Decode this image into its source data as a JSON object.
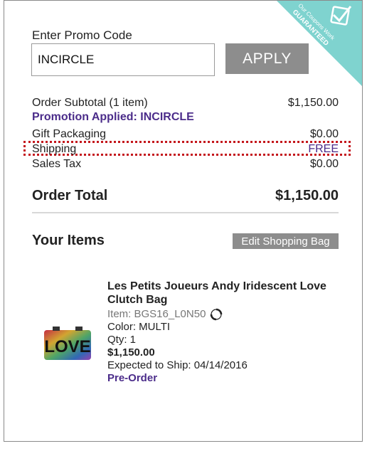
{
  "promo": {
    "label": "Enter Promo Code",
    "input_value": "INCIRCLE",
    "apply_label": "APPLY"
  },
  "badge": {
    "line1": "Our Coupons Work",
    "line2": "GUARANTEED",
    "icon": "checkmark-icon",
    "color": "#7fd3cf"
  },
  "summary": {
    "subtotal_label": "Order Subtotal (1 item)",
    "subtotal_value": "$1,150.00",
    "promotion_text": "Promotion Applied: INCIRCLE",
    "gift_label": "Gift Packaging",
    "gift_value": "$0.00",
    "shipping_label": "Shipping",
    "shipping_value": "FREE",
    "tax_label": "Sales Tax",
    "tax_value": "$0.00",
    "total_label": "Order Total",
    "total_value": "$1,150.00"
  },
  "items_section": {
    "title": "Your Items",
    "edit_label": "Edit Shopping Bag"
  },
  "item": {
    "name": "Les Petits Joueurs Andy Iridescent Love Clutch Bag",
    "item_id": "Item: BGS16_L0N50",
    "color": "Color: MULTI",
    "qty": "Qty: 1",
    "price": "$1,150.00",
    "ship": "Expected to Ship: 04/14/2016",
    "status": "Pre-Order",
    "thumbnail_text": "LOVE",
    "id_icon": "sync-icon"
  },
  "colors": {
    "accent_purple": "#4b2c8a",
    "button_gray": "#8d8d8d",
    "highlight_red": "#c4161c"
  }
}
